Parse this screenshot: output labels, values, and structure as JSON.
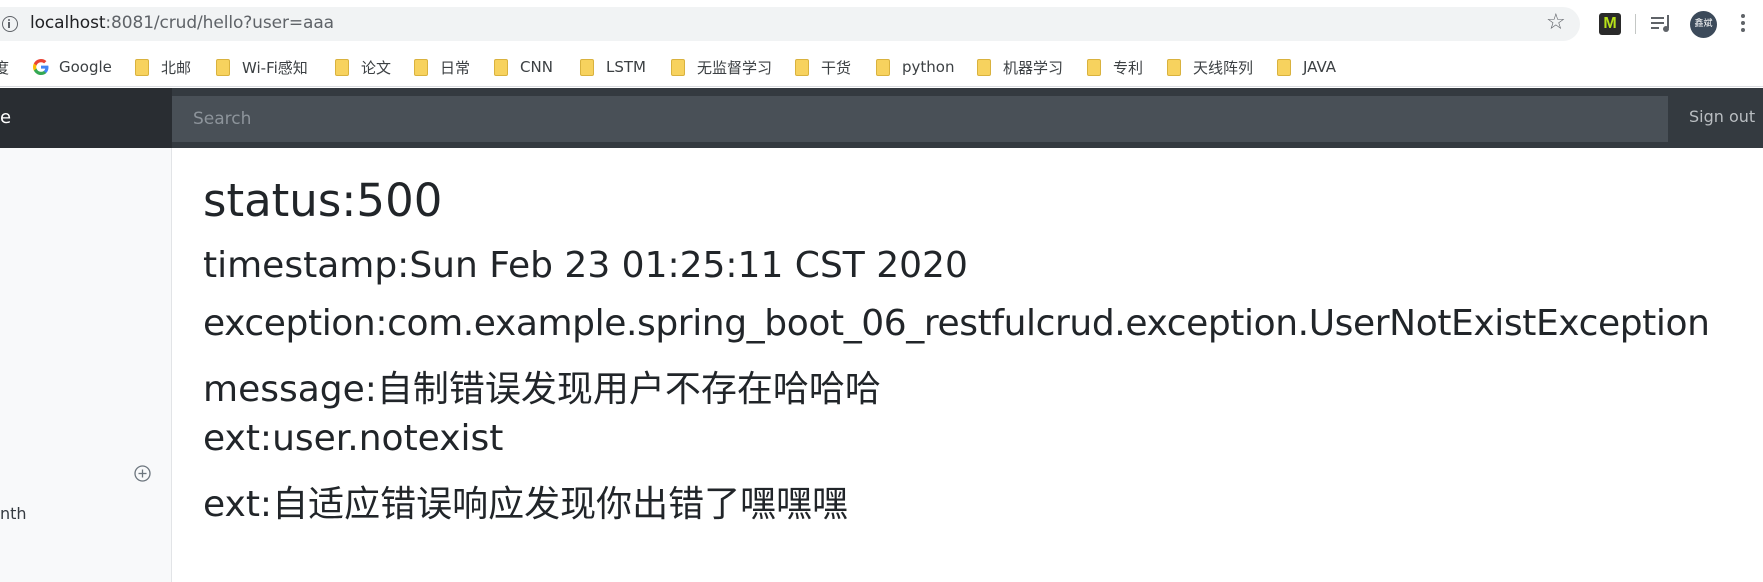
{
  "browser": {
    "url_host": "localhost",
    "url_rest": ":8081/crud/hello?user=aaa",
    "extension_label": "M",
    "avatar_text": "鑫斌"
  },
  "bookmarks": [
    {
      "label": "度",
      "icon": "folder-icon",
      "partial": true
    },
    {
      "label": "Google",
      "icon": "google-icon"
    },
    {
      "label": "北邮",
      "icon": "folder-icon"
    },
    {
      "label": "Wi-Fi感知",
      "icon": "folder-icon"
    },
    {
      "label": "论文",
      "icon": "folder-icon"
    },
    {
      "label": "日常",
      "icon": "folder-icon"
    },
    {
      "label": "CNN",
      "icon": "folder-icon"
    },
    {
      "label": "LSTM",
      "icon": "folder-icon"
    },
    {
      "label": "无监督学习",
      "icon": "folder-icon"
    },
    {
      "label": "干货",
      "icon": "folder-icon"
    },
    {
      "label": "python",
      "icon": "folder-icon"
    },
    {
      "label": "机器学习",
      "icon": "folder-icon"
    },
    {
      "label": "专利",
      "icon": "folder-icon"
    },
    {
      "label": "天线阵列",
      "icon": "folder-icon"
    },
    {
      "label": "JAVA",
      "icon": "folder-icon"
    }
  ],
  "header": {
    "brand": "e",
    "search_placeholder": "Search",
    "signout_label": "Sign out"
  },
  "sidebar": {
    "partial_item": "nth"
  },
  "error": {
    "status": "status:500",
    "timestamp": "timestamp:Sun Feb 23 01:25:11 CST 2020",
    "exception": "exception:com.example.spring_boot_06_restfulcrud.exception.UserNotExistException",
    "message": "message:自制错误发现用户不存在哈哈哈",
    "ext1": "ext:user.notexist",
    "ext2": "ext:自适应错误响应发现你出错了嘿嘿嘿"
  },
  "colors": {
    "header_bg": "#343a40",
    "search_bg": "#495057",
    "sidebar_bg": "#f8f9fa",
    "text": "#212529"
  }
}
